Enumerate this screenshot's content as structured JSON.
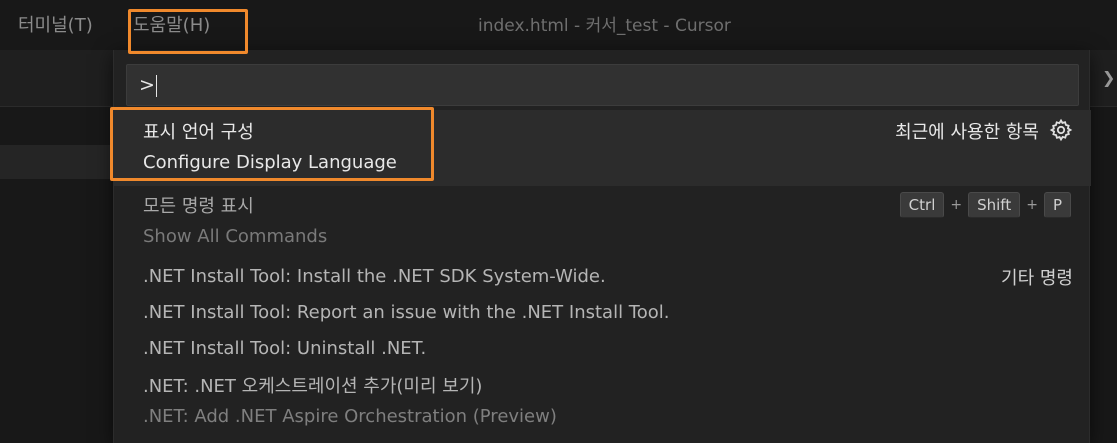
{
  "menubar": {
    "terminal": "터미널(T)",
    "help": "도움말(H)"
  },
  "window": {
    "title": "index.html - 커서_test - Cursor"
  },
  "palette": {
    "input_value": ">",
    "selected": {
      "label_ko": "표시 언어 구성",
      "label_en": "Configure Display Language",
      "group": "최근에 사용한 항목",
      "icon": "gear-icon"
    },
    "show_all": {
      "label_ko": "모든 명령 표시",
      "label_en": "Show All Commands",
      "keys": [
        "Ctrl",
        "Shift",
        "P"
      ],
      "plus": "+"
    },
    "other_group": "기타 명령",
    "items": [
      ".NET Install Tool: Install the .NET SDK System-Wide.",
      ".NET Install Tool: Report an issue with the .NET Install Tool.",
      ".NET Install Tool: Uninstall .NET.",
      ".NET: .NET 오케스트레이션 추가(미리 보기)",
      ".NET: Add .NET Aspire Orchestration (Preview)"
    ]
  },
  "colors": {
    "highlight": "#f0892c",
    "palette_bg": "#222222",
    "selected_bg": "#2c2c2c"
  }
}
